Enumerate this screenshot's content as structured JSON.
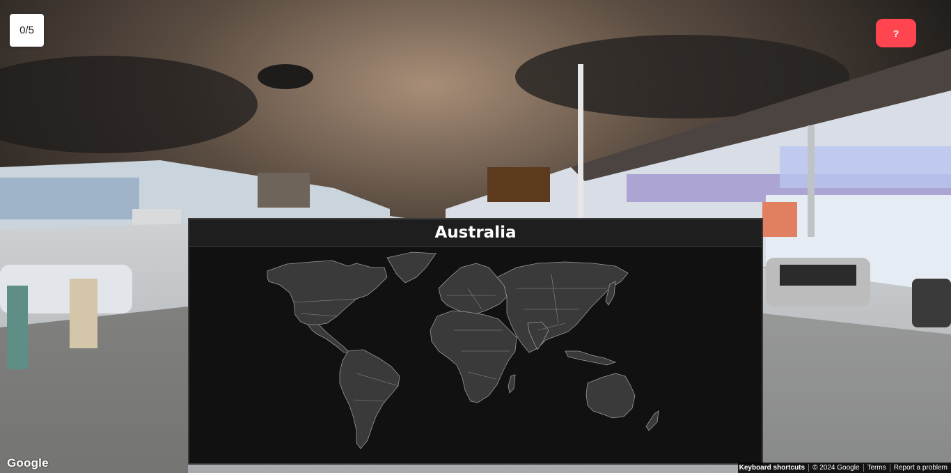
{
  "game": {
    "score": "0/5",
    "help_label": "?",
    "country_prompt": "Australia"
  },
  "icons": {
    "help": "question-icon",
    "map": "world-map"
  },
  "colors": {
    "help_button": "#ff4550",
    "map_background": "#111111",
    "country_fill": "#3a3a3a",
    "country_border": "#9a9a9a"
  },
  "attribution": {
    "logo": "Google",
    "keyboard_shortcuts": "Keyboard shortcuts",
    "copyright": "© 2024 Google",
    "terms": "Terms",
    "report": "Report a problem"
  }
}
